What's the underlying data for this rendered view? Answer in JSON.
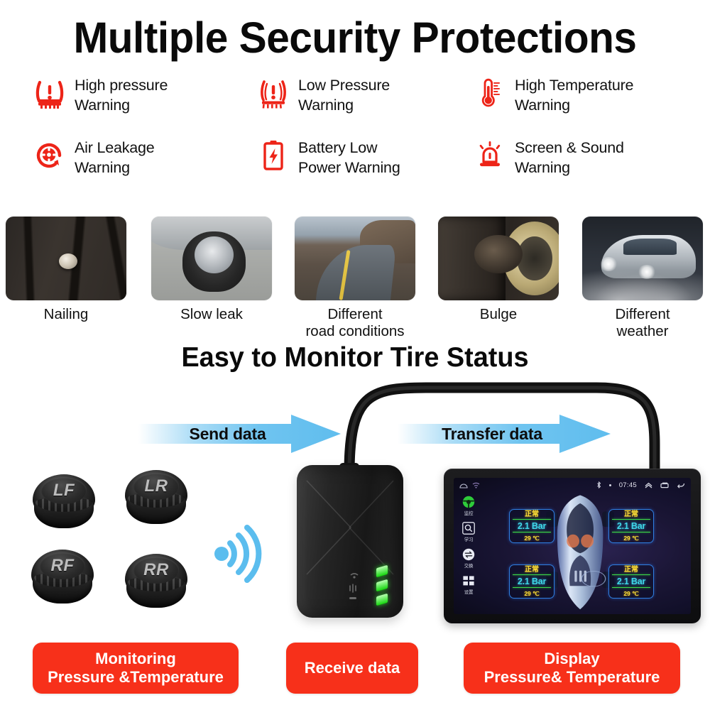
{
  "header": {
    "title": "Multiple Security Protections"
  },
  "features": [
    {
      "icon": "tire-pressure-high-icon",
      "line1": "High pressure",
      "line2": "Warning"
    },
    {
      "icon": "tire-pressure-low-icon",
      "line1": "Low Pressure",
      "line2": "Warning"
    },
    {
      "icon": "thermometer-icon",
      "line1": "High Temperature",
      "line2": "Warning"
    },
    {
      "icon": "air-leakage-icon",
      "line1": "Air Leakage",
      "line2": "Warning"
    },
    {
      "icon": "battery-low-icon",
      "line1": "Battery Low",
      "line2": "Power Warning"
    },
    {
      "icon": "siren-alarm-icon",
      "line1": "Screen & Sound",
      "line2": "Warning"
    }
  ],
  "scenarios": [
    {
      "photo": "tire-nail-photo",
      "line1": "Nailing",
      "line2": ""
    },
    {
      "photo": "slow-leak-photo",
      "line1": "Slow leak",
      "line2": ""
    },
    {
      "photo": "mountain-road-photo",
      "line1": "Different",
      "line2": "road conditions"
    },
    {
      "photo": "tire-bulge-photo",
      "line1": "Bulge",
      "line2": ""
    },
    {
      "photo": "rain-driving-photo",
      "line1": "Different",
      "line2": "weather"
    }
  ],
  "subtitle": {
    "text": "Easy to Monitor Tire Status"
  },
  "diagram": {
    "sensors": [
      {
        "label": "LF"
      },
      {
        "label": "LR"
      },
      {
        "label": "RF"
      },
      {
        "label": "RR"
      }
    ],
    "arrows": [
      {
        "label": "Send data"
      },
      {
        "label": "Transfer data"
      }
    ],
    "tablet": {
      "statusbar": {
        "time": "07:45",
        "icons_left": [
          "home-icon",
          "wifi-icon"
        ],
        "icons_right": [
          "bluetooth-icon",
          "dot-icon",
          "chevron-up-icon",
          "recent-apps-icon",
          "back-icon"
        ]
      },
      "sidebar": [
        {
          "icon": "steering-wheel-icon",
          "label": "监控"
        },
        {
          "icon": "search-icon",
          "label": "学习"
        },
        {
          "icon": "exchange-icon",
          "label": "交换"
        },
        {
          "icon": "grid-settings-icon",
          "label": "设置"
        }
      ],
      "tires": [
        {
          "position": "front-left",
          "status": "正常",
          "pressure": "2.1 Bar",
          "temperature": "29 ℃"
        },
        {
          "position": "front-right",
          "status": "正常",
          "pressure": "2.1 Bar",
          "temperature": "29 ℃"
        },
        {
          "position": "rear-left",
          "status": "正常",
          "pressure": "2.1 Bar",
          "temperature": "29 ℃"
        },
        {
          "position": "rear-right",
          "status": "正常",
          "pressure": "2.1 Bar",
          "temperature": "29 ℃"
        }
      ]
    }
  },
  "captions": [
    {
      "line1": "Monitoring",
      "line2": "Pressure &Temperature"
    },
    {
      "line1": "Receive data",
      "line2": ""
    },
    {
      "line1": "Display",
      "line2": "Pressure& Temperature"
    }
  ],
  "colors": {
    "warning_red": "#ED2418",
    "caption_red": "#F7301A",
    "arrow_blue": "#6FC4F0",
    "led_green": "#16D60E",
    "pressure_cyan": "#3FD8E8",
    "status_yellow": "#FFE23A"
  }
}
